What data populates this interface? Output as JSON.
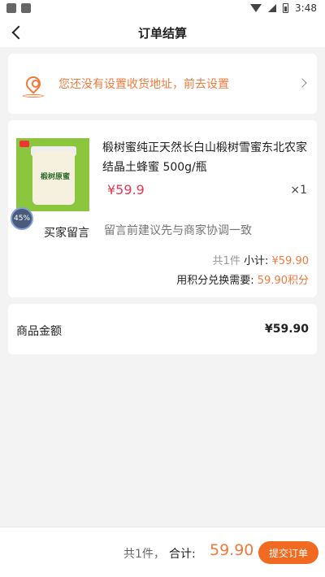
{
  "status_bar": {
    "time": "3:48"
  },
  "nav": {
    "title": "订单结算"
  },
  "address": {
    "prompt": "您还没有设置收货地址，前去设置"
  },
  "product": {
    "name": "椴树蜜纯正天然长白山椴树雪蜜东北农家结晶土蜂蜜 500g/瓶",
    "price": "¥59.9",
    "qty": "×1",
    "badge_progress": "45%",
    "label_text": "椴树原蜜"
  },
  "message": {
    "label": "买家留言",
    "placeholder": "留言前建议先与商家协调一致"
  },
  "order_summary": {
    "count": "共1件",
    "subtotal_label": "小计:",
    "subtotal": "¥59.90",
    "points_label": "用积分兑换需要:",
    "points": "59.90积分"
  },
  "goods_total": {
    "label": "商品金额",
    "value": "¥59.90"
  },
  "footer": {
    "count": "共1件，",
    "total_label": "合计:",
    "total": "59.90",
    "submit_label": "提交订单"
  },
  "colors": {
    "accent": "#f07a3c",
    "price": "#e8384f",
    "button": "#f06a22"
  }
}
